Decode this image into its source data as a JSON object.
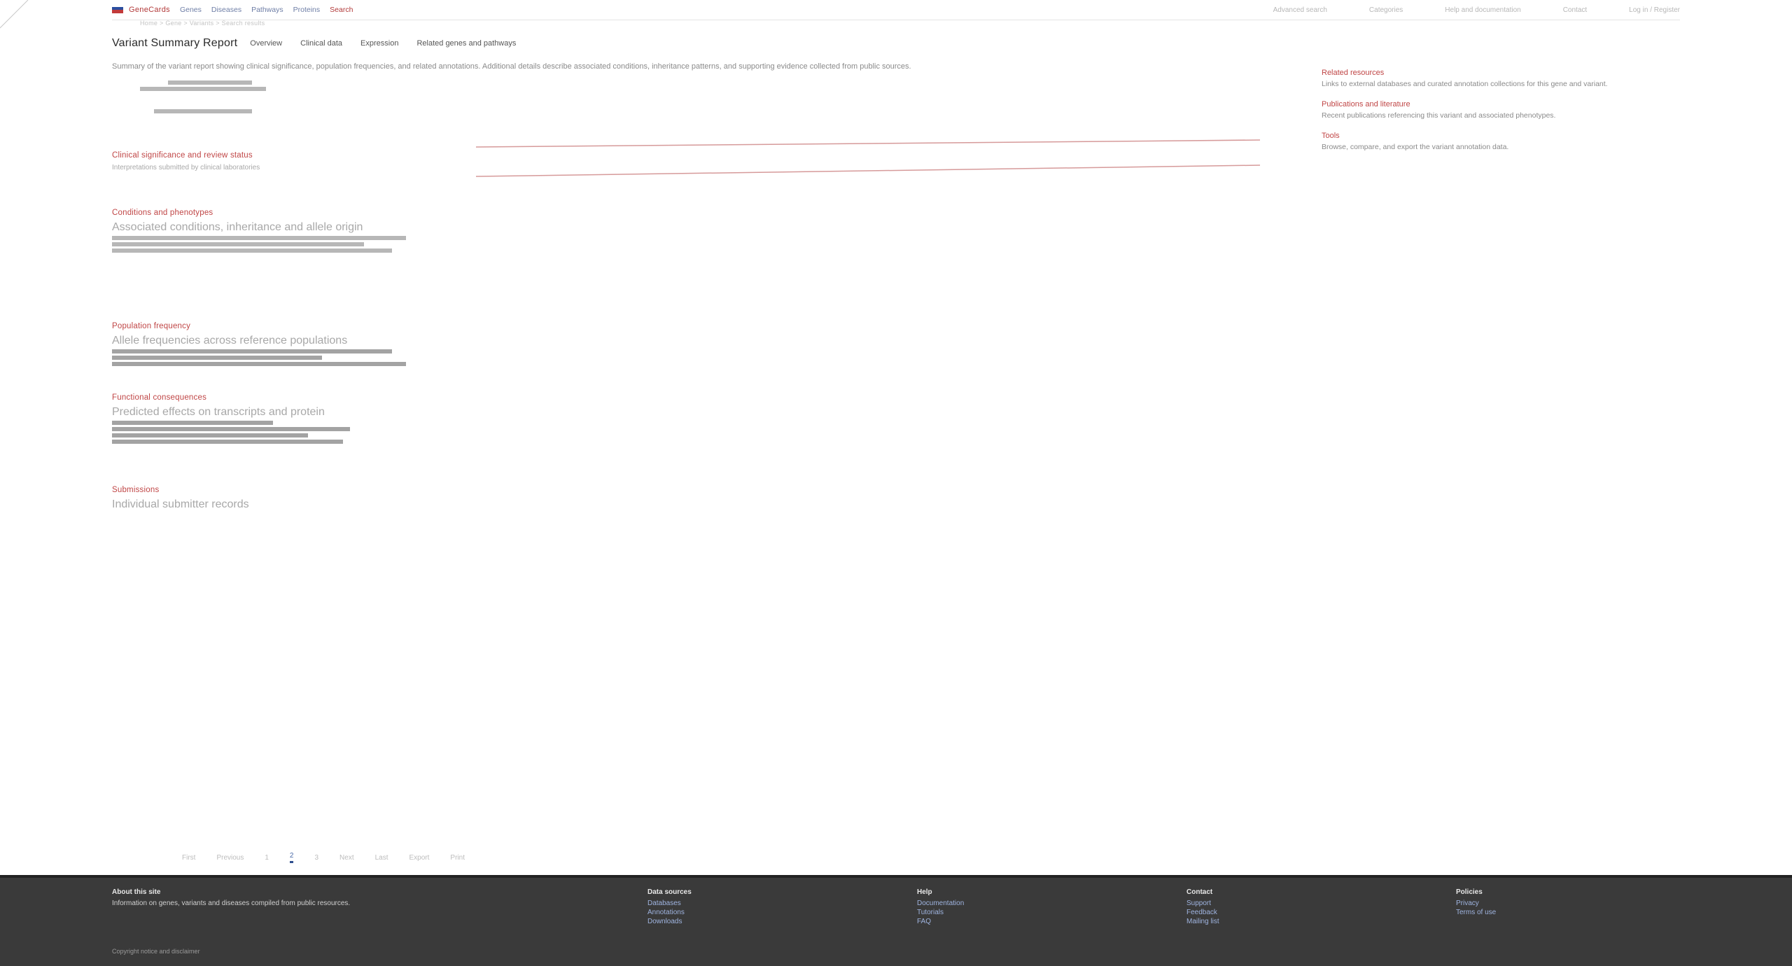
{
  "nav": {
    "brand": "GeneCards",
    "links": [
      "Genes",
      "Diseases",
      "Pathways",
      "Proteins"
    ],
    "red_link": "Search",
    "right": [
      "Advanced search",
      "Categories",
      "Help and documentation",
      "Contact",
      "Log in / Register"
    ],
    "breadcrumb": "Home > Gene > Variants > Search results"
  },
  "title": {
    "text": "Variant Summary Report",
    "tabs": [
      "Overview",
      "Clinical data",
      "Expression",
      "Related genes and pathways"
    ]
  },
  "summary": "Summary of the variant report showing clinical significance, population frequencies, and related annotations. Additional details describe associated conditions, inheritance patterns, and supporting evidence collected from public sources.",
  "sidebar": [
    {
      "heading": "Related resources",
      "text": "Links to external databases and curated annotation collections for this gene and variant."
    },
    {
      "heading": "Publications and literature",
      "text": "Recent publications referencing this variant and associated phenotypes."
    },
    {
      "heading": "Tools",
      "text": "Browse, compare, and export the variant annotation data."
    }
  ],
  "sections": [
    {
      "title": "Clinical significance and review status",
      "note": "Interpretations submitted by clinical laboratories"
    },
    {
      "title": "Conditions and phenotypes",
      "note": "Associated conditions, inheritance and allele origin"
    },
    {
      "title": "Population frequency",
      "note": "Allele frequencies across reference populations"
    },
    {
      "title": "Functional consequences",
      "note": "Predicted effects on transcripts and protein"
    },
    {
      "title": "Submissions",
      "note": "Individual submitter records"
    }
  ],
  "pager": [
    "First",
    "Previous",
    "1",
    "2",
    "3",
    "Next",
    "Last",
    "Export",
    "Print"
  ],
  "footer": {
    "about_title": "About this site",
    "about_text": "Information on genes, variants and diseases compiled from public resources.",
    "cols": [
      {
        "h": "Data sources",
        "links": [
          "Databases",
          "Annotations",
          "Downloads"
        ]
      },
      {
        "h": "Help",
        "links": [
          "Documentation",
          "Tutorials",
          "FAQ"
        ]
      },
      {
        "h": "Contact",
        "links": [
          "Support",
          "Feedback",
          "Mailing list"
        ]
      },
      {
        "h": "Policies",
        "links": [
          "Privacy",
          "Terms of use"
        ]
      }
    ],
    "small": "Copyright notice and disclaimer"
  }
}
